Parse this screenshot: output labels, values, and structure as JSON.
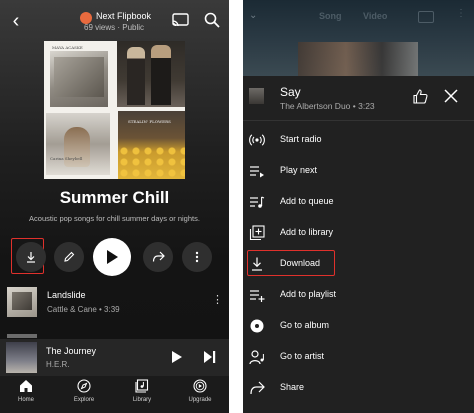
{
  "left_screen": {
    "header": {
      "playlist_owner": "Next Flipbook",
      "playlist_stats": "69 views · Public"
    },
    "cover_art_text": {
      "top_left": "MAYA ACASKE",
      "bottom_left": "Carina Sheybell",
      "sunflower": "STEALIN' FLOWERS"
    },
    "playlist": {
      "title": "Summer Chill",
      "description": "Acoustic pop songs for chill summer days or nights."
    },
    "songs": [
      {
        "title": "Landslide",
        "meta": "Cattle & Cane • 3:39"
      }
    ],
    "miniplayer": {
      "title": "The Journey",
      "artist": "H.E.R."
    },
    "bottom_nav": [
      {
        "label": "Home",
        "icon": "home-icon"
      },
      {
        "label": "Explore",
        "icon": "compass-icon"
      },
      {
        "label": "Library",
        "icon": "library-icon"
      },
      {
        "label": "Upgrade",
        "icon": "upgrade-icon"
      }
    ],
    "highlight_color": "#e0312c"
  },
  "right_screen": {
    "background_tabs": {
      "song": "Song",
      "video": "Video"
    },
    "sheet": {
      "title": "Say",
      "subtitle": "The Albertson Duo • 3:23"
    },
    "menu_items": [
      {
        "label": "Start radio",
        "icon": "radio-icon"
      },
      {
        "label": "Play next",
        "icon": "play-next-icon"
      },
      {
        "label": "Add to queue",
        "icon": "queue-icon"
      },
      {
        "label": "Add to library",
        "icon": "library-add-icon"
      },
      {
        "label": "Download",
        "icon": "download-icon",
        "highlighted": true
      },
      {
        "label": "Add to playlist",
        "icon": "playlist-add-icon"
      },
      {
        "label": "Go to album",
        "icon": "album-icon"
      },
      {
        "label": "Go to artist",
        "icon": "artist-icon"
      },
      {
        "label": "Share",
        "icon": "share-icon"
      }
    ]
  }
}
